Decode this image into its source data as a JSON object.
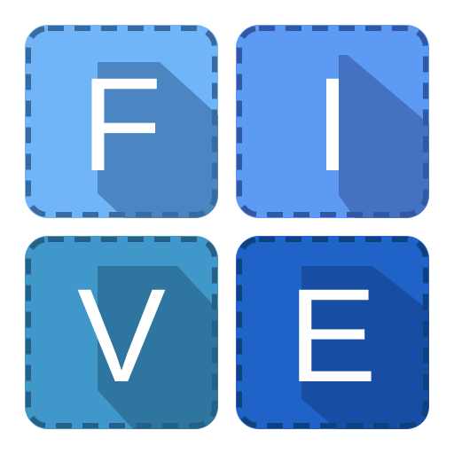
{
  "tiles": [
    {
      "letter": "F",
      "fill": "#6fb5f7",
      "shadow": "#3f75b0",
      "dash": "#3a6a9e"
    },
    {
      "letter": "I",
      "fill": "#5c9af4",
      "shadow": "#3c63b0",
      "dash": "#3357a3"
    },
    {
      "letter": "V",
      "fill": "#3f98c9",
      "shadow": "#2a6a90",
      "dash": "#285f85"
    },
    {
      "letter": "E",
      "fill": "#1f63c9",
      "shadow": "#154696",
      "dash": "#11407f"
    }
  ]
}
